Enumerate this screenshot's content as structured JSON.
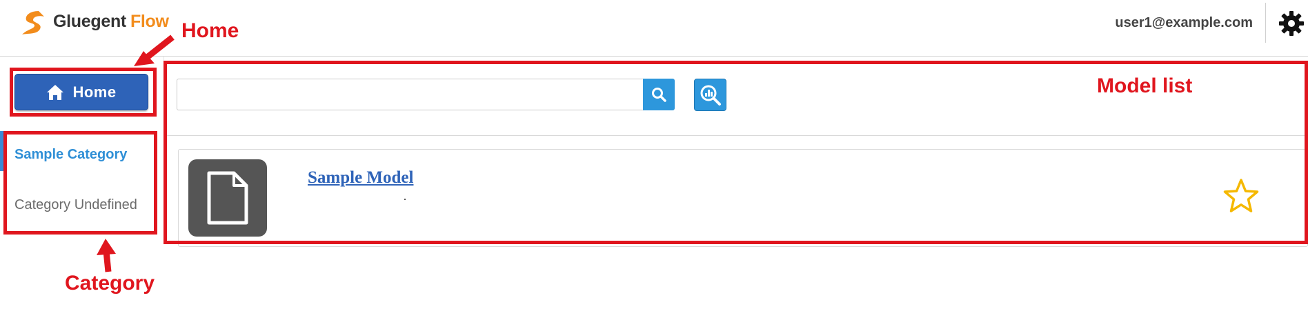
{
  "header": {
    "brand_name": "Gluegent",
    "brand_product": "Flow",
    "user_email": "user1@example.com"
  },
  "sidebar": {
    "home_label": "Home",
    "categories": [
      {
        "label": "Sample Category",
        "active": true
      },
      {
        "label": "Category Undefined",
        "active": false
      }
    ]
  },
  "main": {
    "search": {
      "value": "",
      "placeholder": ""
    },
    "models": [
      {
        "title": "Sample Model",
        "favorite": false,
        "icon": "document-icon"
      }
    ]
  },
  "annotations": {
    "home": "Home",
    "model_list": "Model list",
    "category": "Category"
  },
  "colors": {
    "primary": "#2e63b8",
    "accent": "#2d97dc",
    "brand_orange": "#f28c1c",
    "annotation_red": "#e0161e",
    "star": "#f5b800"
  }
}
